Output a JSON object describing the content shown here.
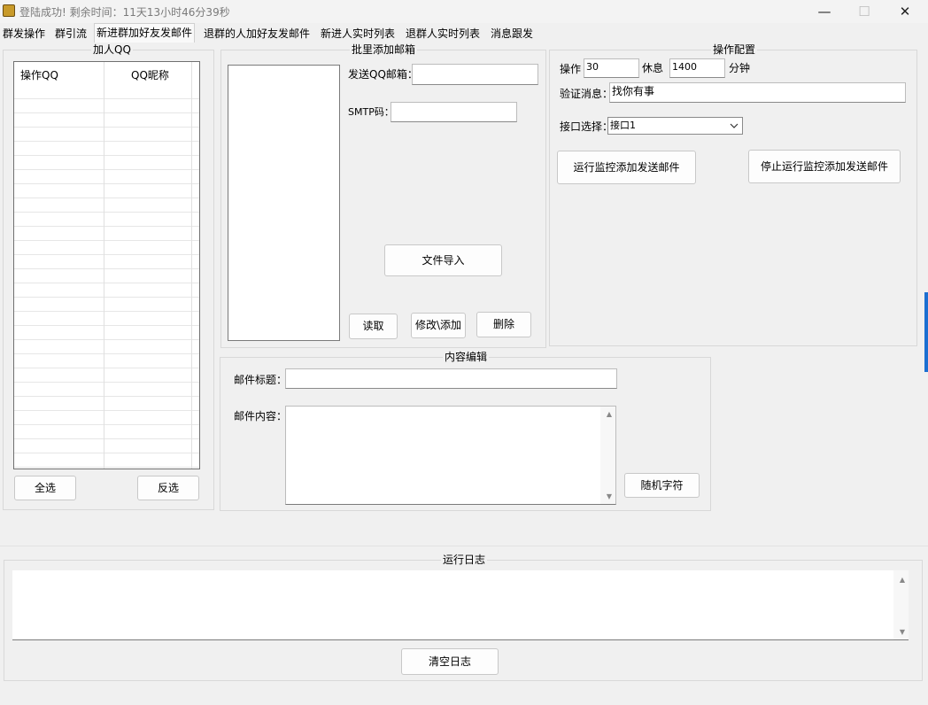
{
  "window": {
    "title": "登陆成功! 剩余时间：11天13小时46分39秒",
    "minimize": "—",
    "maximize": "☐",
    "close": "✕"
  },
  "tabs": [
    "群发操作",
    "群引流",
    "新进群加好友发邮件",
    "退群的人加好友发邮件",
    "新进人实时列表",
    "退群人实时列表",
    "消息跟发"
  ],
  "add_qq": {
    "title": "加人QQ",
    "columns": [
      "操作QQ",
      "QQ昵称"
    ],
    "select_all": "全选",
    "invert": "反选"
  },
  "batch_email": {
    "title": "批里添加邮箱",
    "sender_label": "发送QQ邮箱：",
    "sender_value": "",
    "smtp_label": "SMTP码：",
    "smtp_value": "",
    "import_button": "文件导入",
    "read_button": "读取",
    "modify_button": "修改\\添加",
    "delete_button": "删除"
  },
  "config": {
    "title": "操作配置",
    "op_label": "操作",
    "op_value": "30",
    "rest_label": "休息",
    "rest_value": "1400",
    "minute_label": "分钟",
    "verify_label": "验证消息：",
    "verify_value": "找你有事",
    "api_label": "接口选择：",
    "api_value": "接口1",
    "run_button": "运行监控添加发送邮件",
    "stop_button": "停止运行监控添加发送邮件"
  },
  "content": {
    "title": "内容编辑",
    "subject_label": "邮件标题：",
    "subject_value": "",
    "body_label": "邮件内容：",
    "random_button": "随机字符"
  },
  "log": {
    "title": "运行日志",
    "clear_button": "清空日志"
  },
  "icons": {
    "app": "app-icon",
    "scroll_up": "▲",
    "scroll_down": "▼",
    "dropdown": "chevron-down-icon"
  },
  "colors": {
    "window_bg": "#f0f0f0",
    "title_text": "#7a7a7a",
    "accent_right_edge": "#1c6fd1"
  }
}
